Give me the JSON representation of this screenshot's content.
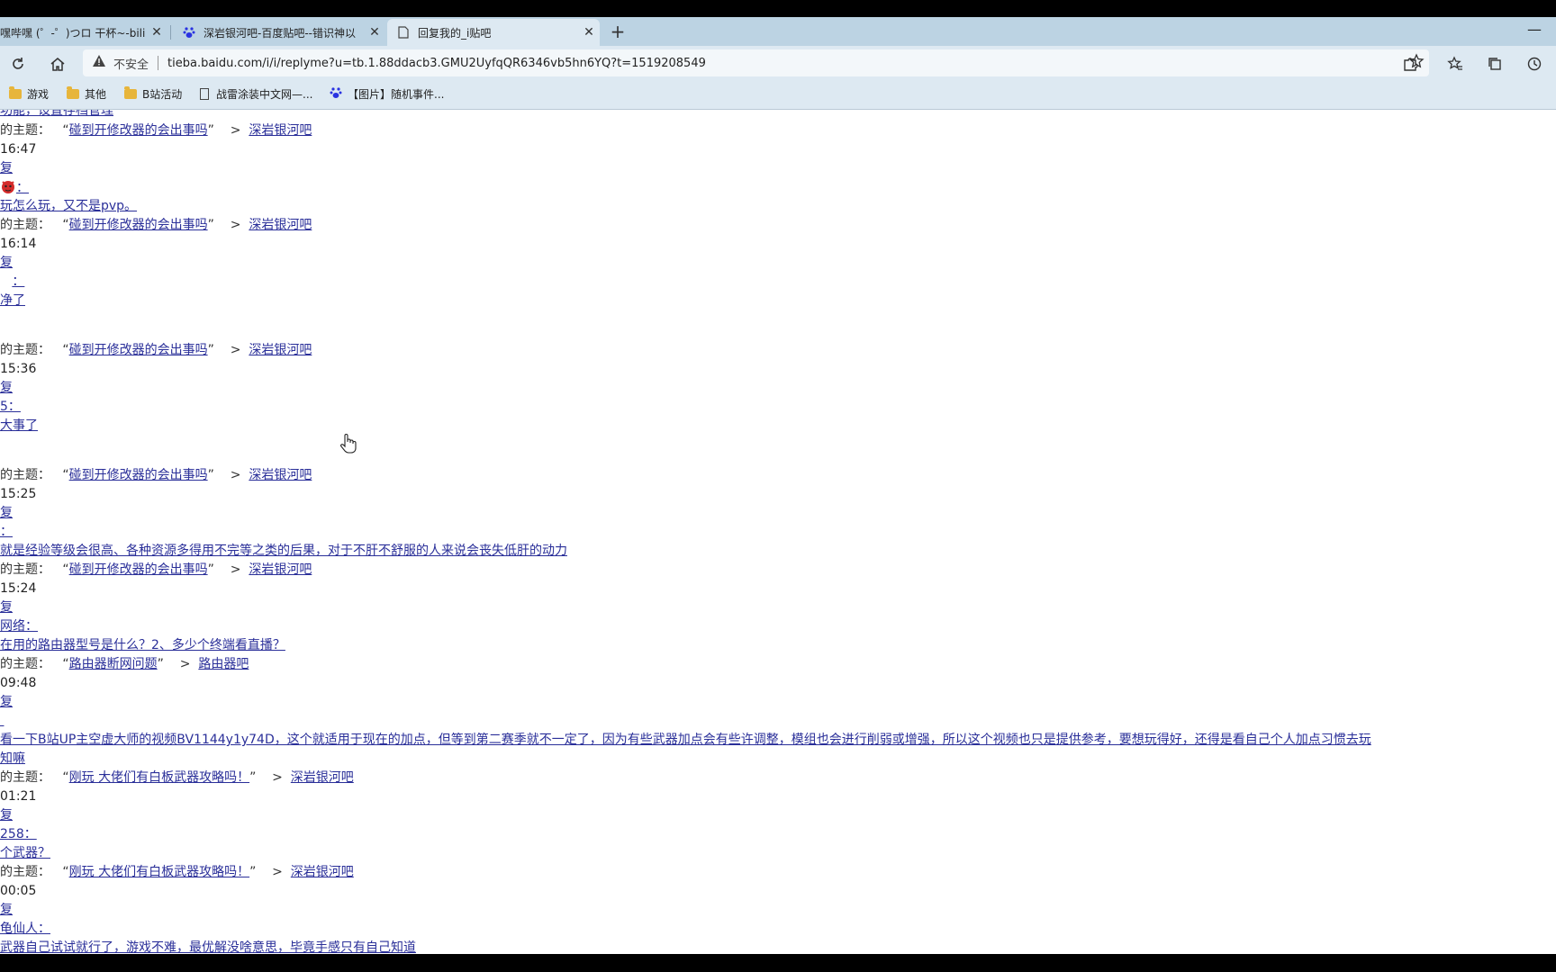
{
  "tabs": [
    {
      "title": "嘿哔嘿 (゜-゜)つロ 干杯~-bilibili",
      "close": "✕"
    },
    {
      "title": "深岩银河吧-百度贴吧--错识神以",
      "close": "✕"
    },
    {
      "title": "回复我的_i贴吧",
      "close": "✕"
    }
  ],
  "new_tab_label": "+",
  "minimize_label": "—",
  "address": {
    "security": "不安全",
    "url": "tieba.baidu.com/i/i/replyme?u=tb.1.88ddacb3.GMU2UyfqQR6346vb5hn6YQ?t=1519208549"
  },
  "bookmarks": [
    {
      "label": "游戏",
      "type": "folder"
    },
    {
      "label": "其他",
      "type": "folder"
    },
    {
      "label": "B站活动",
      "type": "folder"
    },
    {
      "label": "战雷涂装中文网—...",
      "type": "page"
    },
    {
      "label": "【图片】随机事件...",
      "type": "paw"
    }
  ],
  "content": {
    "top_partial": "功能，设置存档管理",
    "topic_prefix": "的主题：",
    "open_quote": "“",
    "close_quote": "”",
    "arrow": ">",
    "reply_label": "复",
    "items": [
      {
        "topic": "碰到开修改器的会出事吗",
        "forum": "深岩银河吧",
        "time": "16:47",
        "user": "：",
        "text": "玩怎么玩，又不是pvp。"
      },
      {
        "topic": "碰到开修改器的会出事吗",
        "forum": "深岩银河吧",
        "time": "16:14",
        "user": "：",
        "text": "净了"
      },
      {
        "topic": "碰到开修改器的会出事吗",
        "forum": "深岩银河吧",
        "time": "15:36",
        "user": "5：",
        "text": "大事了"
      },
      {
        "topic": "碰到开修改器的会出事吗",
        "forum": "深岩银河吧",
        "time": "15:25",
        "user": "：",
        "text": "就是经验等级会很高、各种资源多得用不完等之类的后果，对于不肝不舒服的人来说会丧失低肝的动力"
      },
      {
        "topic": "碰到开修改器的会出事吗",
        "forum": "深岩银河吧",
        "time": "15:24",
        "user": "网络：",
        "text": "在用的路由器型号是什么？2、多少个终端看直播？"
      },
      {
        "topic": "路由器断网问题",
        "forum": "路由器吧",
        "time": "09:48",
        "user": "",
        "text": "看一下B站UP主空虚大师的视频BV1144y1y74D，这个就适用于现在的加点，但等到第二赛季就不一定了，因为有些武器加点会有些许调整，模组也会进行削弱或增强，所以这个视频也只是提供参考，要想玩得好，还得是看自己个人加点习惯去玩",
        "text2": "知嘛"
      },
      {
        "topic": "刚玩 大佬们有白板武器攻略吗！",
        "forum": "深岩银河吧",
        "time": "01:21",
        "user": "258：",
        "text": "个武器？"
      },
      {
        "topic": "刚玩 大佬们有白板武器攻略吗！",
        "forum": "深岩银河吧",
        "time": "00:05",
        "user": "龟仙人：",
        "text": "武器自己试试就行了，游戏不难，最优解没啥意思，毕竟手感只有自己知道"
      }
    ]
  }
}
